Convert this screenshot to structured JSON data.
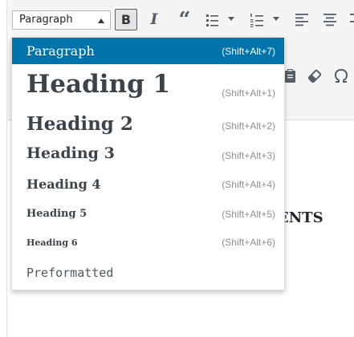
{
  "toolbar": {
    "format_select": {
      "value": "Paragraph"
    },
    "buttons": {
      "bold": "B",
      "italic": "I",
      "blockquote": "“"
    }
  },
  "format_menu": {
    "items": [
      {
        "label": "Paragraph",
        "shortcut": "(Shift+Alt+7)",
        "active": true
      },
      {
        "label": "Heading 1",
        "shortcut": "(Shift+Alt+1)"
      },
      {
        "label": "Heading 2",
        "shortcut": "(Shift+Alt+2)"
      },
      {
        "label": "Heading 3",
        "shortcut": "(Shift+Alt+3)"
      },
      {
        "label": "Heading 4",
        "shortcut": "(Shift+Alt+4)"
      },
      {
        "label": "Heading 5",
        "shortcut": "(Shift+Alt+5)"
      },
      {
        "label": "Heading 6",
        "shortcut": "(Shift+Alt+6)"
      },
      {
        "label": "Preformatted",
        "shortcut": ""
      }
    ]
  },
  "editor": {
    "visible_text": "ENTS"
  },
  "colors": {
    "accent": "#0073aa",
    "toolbar_bg": "#f5f5f5",
    "icon": "#555d66"
  },
  "icons": [
    "bullet-list-icon",
    "numbered-list-icon",
    "align-left-icon",
    "align-center-icon",
    "clipboard-icon",
    "eraser-icon",
    "omega-icon",
    "dropdown-caret-icon"
  ]
}
